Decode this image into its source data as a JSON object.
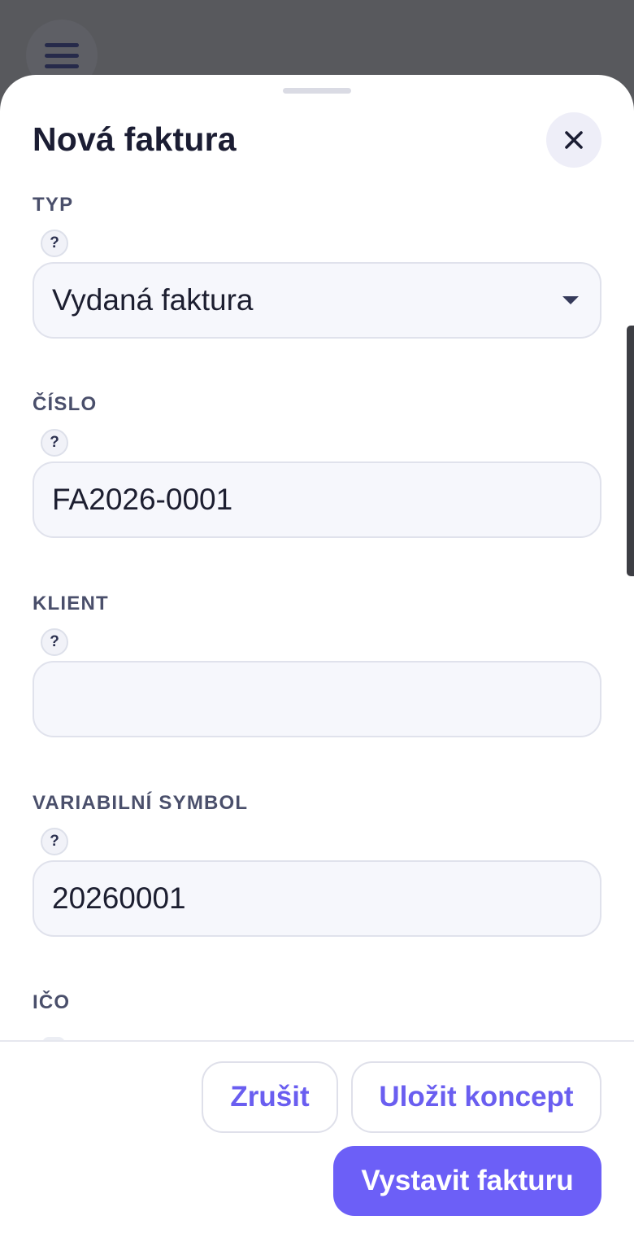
{
  "app": {
    "menu_icon": "hamburger-menu-icon"
  },
  "sheet": {
    "title": "Nová faktura",
    "close_icon": "close-icon"
  },
  "form": {
    "help_symbol": "?",
    "fields": [
      {
        "label": "TYP",
        "type": "select",
        "value": "Vydaná faktura"
      },
      {
        "label": "ČÍSLO",
        "type": "text",
        "value": "FA2026-0001"
      },
      {
        "label": "KLIENT",
        "type": "text",
        "value": ""
      },
      {
        "label": "VARIABILNÍ SYMBOL",
        "type": "text",
        "value": "20260001"
      },
      {
        "label": "IČO",
        "type": "text",
        "value": ""
      }
    ]
  },
  "footer": {
    "cancel_label": "Zrušit",
    "save_draft_label": "Uložit koncept",
    "issue_label": "Vystavit fakturu"
  },
  "colors": {
    "accent": "#6c5ff7",
    "heading": "#1b1d33",
    "label": "#4a4f6b",
    "input_bg": "#f6f7fc",
    "backdrop": "#58595d"
  }
}
